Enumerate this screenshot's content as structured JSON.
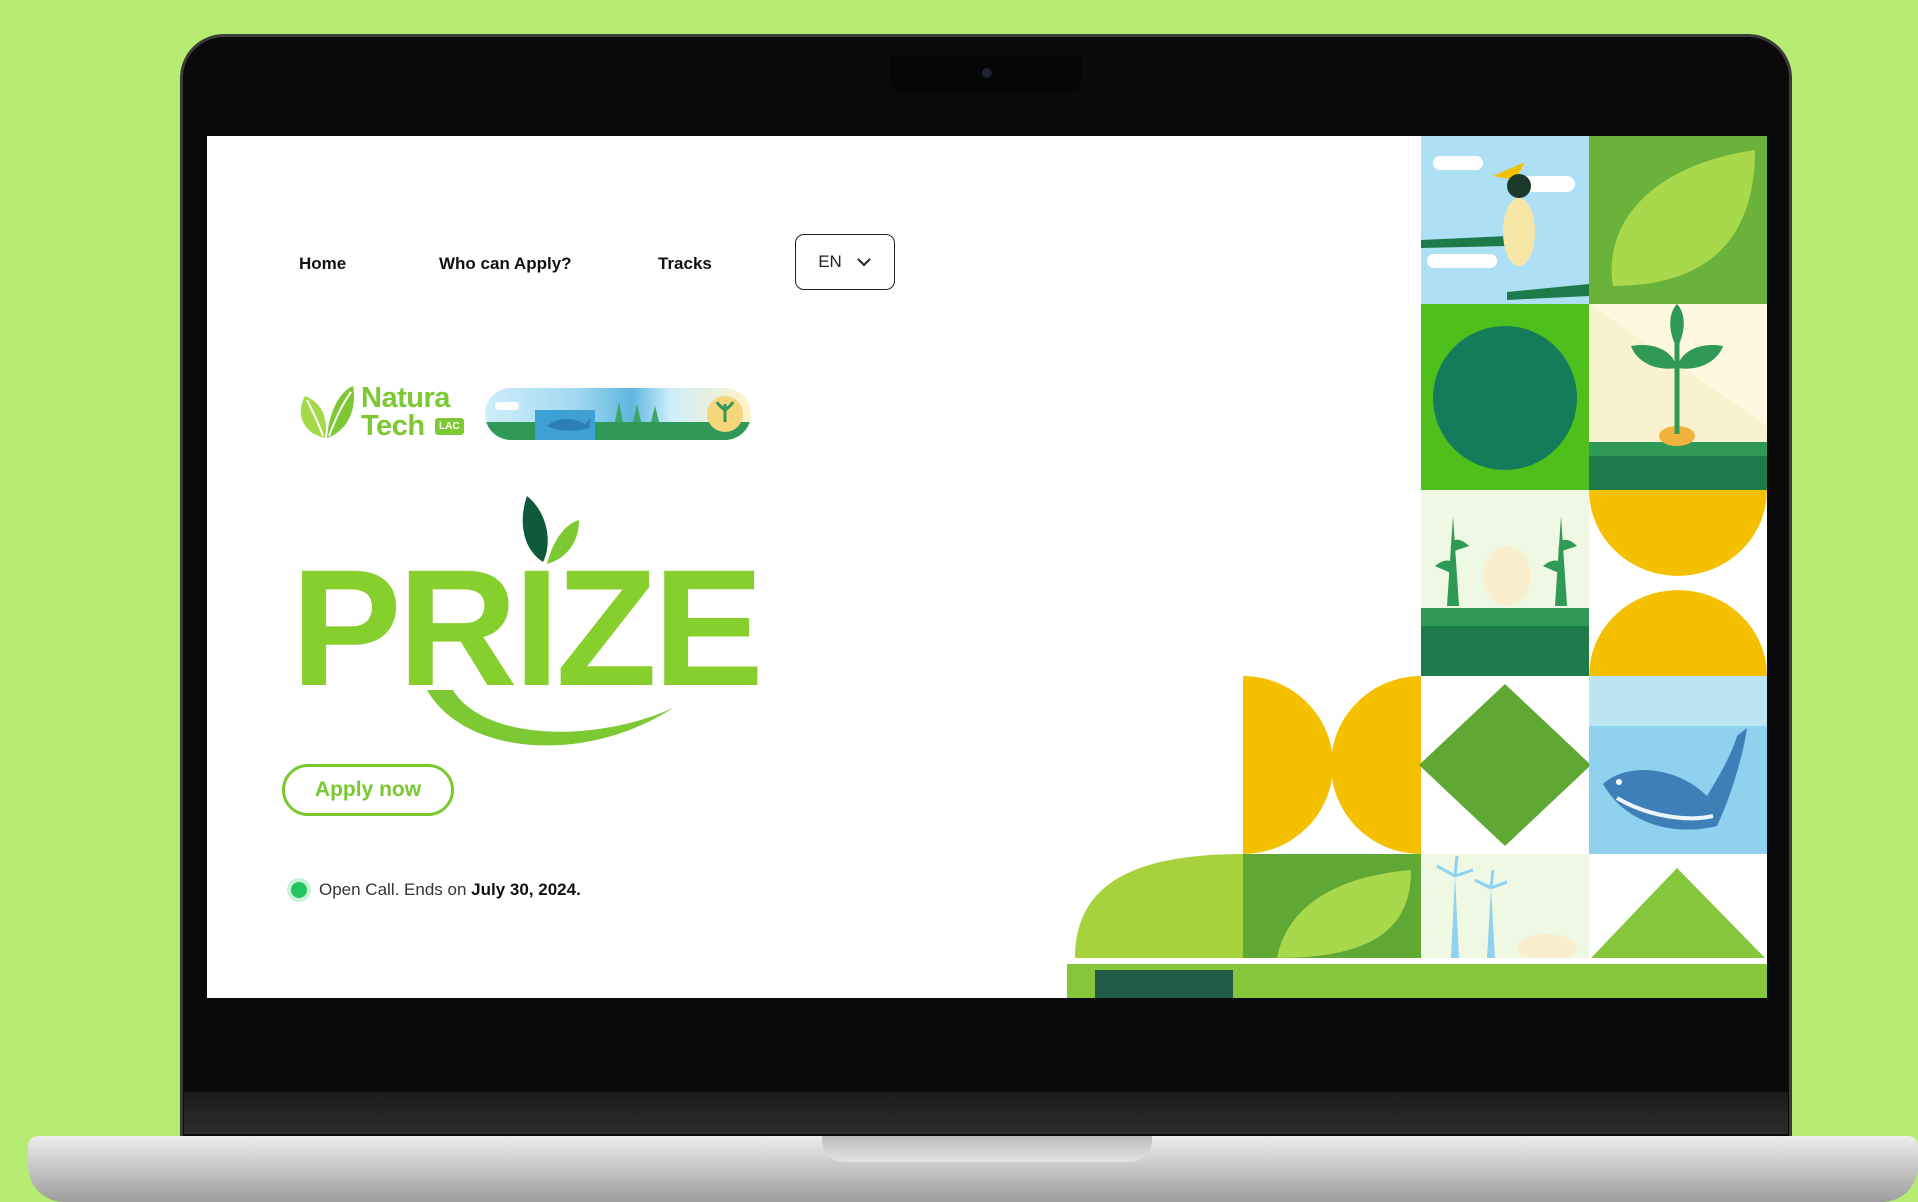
{
  "nav": {
    "home": "Home",
    "who": "Who can Apply?",
    "tracks": "Tracks",
    "language": "EN"
  },
  "logo": {
    "line1": "Natura",
    "line2": "Tech",
    "badge": "LAC"
  },
  "hero": {
    "title": "PRIZE",
    "apply_label": "Apply now"
  },
  "status": {
    "prefix": "Open Call. Ends on ",
    "date": "July 30, 2024."
  },
  "colors": {
    "background": "#b6ec72",
    "brand_green": "#7dc934",
    "status_green": "#22c55e",
    "tile_yellow": "#f5c000",
    "tile_dark_green": "#137c5a"
  }
}
